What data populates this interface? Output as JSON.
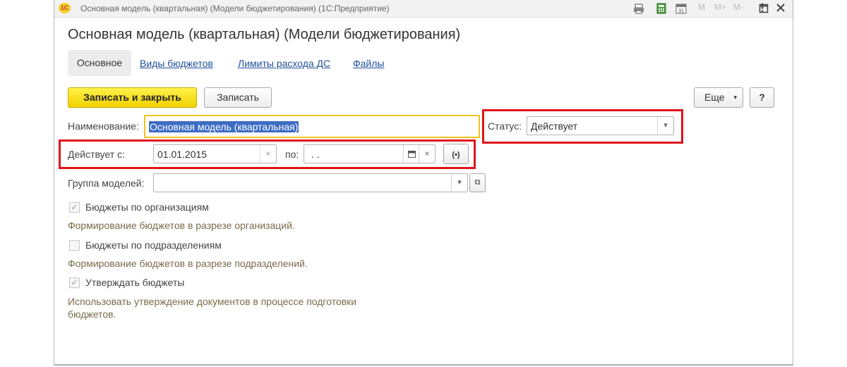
{
  "titlebar": {
    "logo": "1С",
    "title": "Основная модель (квартальная) (Модели бюджетирования)  (1С:Предприятие)",
    "icons": [
      "print-icon",
      "calculator-icon",
      "calendar-icon"
    ],
    "m_labels": [
      "M",
      "M+",
      "M-"
    ]
  },
  "form": {
    "title": "Основная модель (квартальная) (Модели бюджетирования)"
  },
  "tabs": [
    {
      "label": "Основное",
      "active": true
    },
    {
      "label": "Виды  бюджетов"
    },
    {
      "label": "Лимиты расхода ДС"
    },
    {
      "label": "Файлы"
    }
  ],
  "toolbar": {
    "save_close": "Записать и закрыть",
    "save": "Записать",
    "more": "Еще",
    "help": "?"
  },
  "fields": {
    "name_label": "Наименование:",
    "name_value": "Основная модель (квартальная)",
    "status_label": "Статус:",
    "status_value": "Действует",
    "valid_from_label": "Действует с:",
    "valid_from_value": "01.01.2015",
    "to_label": "по:",
    "to_value": " .  .",
    "group_label": "Группа моделей:",
    "group_value": ""
  },
  "options": [
    {
      "label": "Бюджеты по организациям",
      "checked": true,
      "hint": "Формирование бюджетов в разрезе организаций."
    },
    {
      "label": "Бюджеты по подразделениям",
      "checked": false,
      "hint": "Формирование бюджетов в разрезе подразделений."
    },
    {
      "label": "Утверждать бюджеты",
      "checked": true,
      "hint": "Использовать утверждение документов в процессе подготовки бюджетов."
    }
  ],
  "colors": {
    "highlight": "#e0131c",
    "primary_button": "#f5dc14",
    "link": "#1e4f99",
    "hint_text": "#7b6a48"
  }
}
